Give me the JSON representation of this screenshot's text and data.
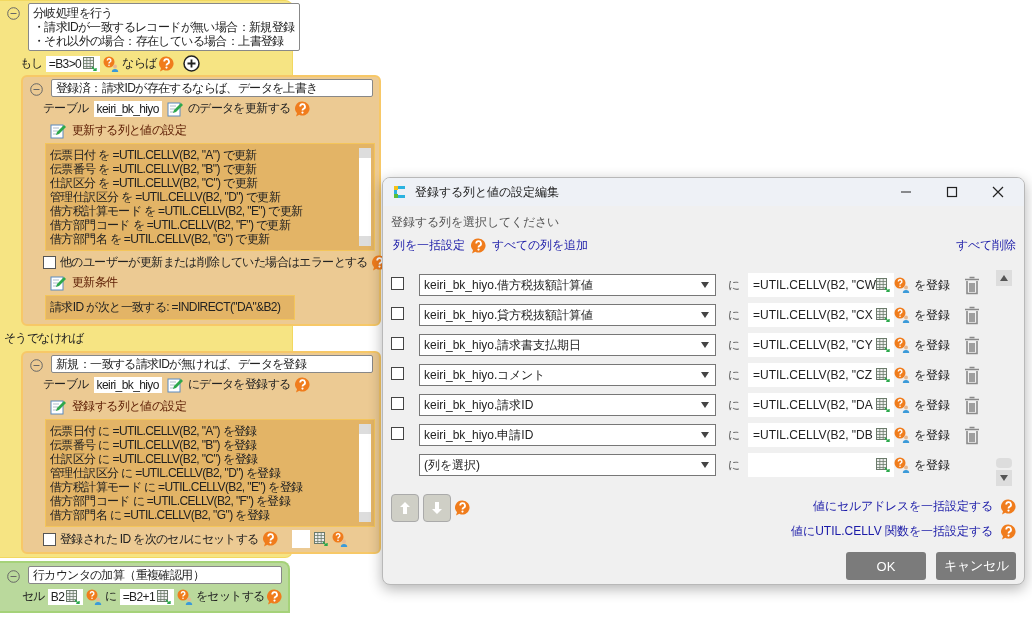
{
  "branch": {
    "title_lines": [
      "分岐処理を行う",
      "・請求IDが一致するレコードが無い場合：新規登録",
      "・それ以外の場合：存在している場合：上書登録"
    ],
    "if_label": "もし",
    "condition": "=B3>0",
    "then_label": "ならば",
    "then_block": {
      "title": "登録済：請求IDが存在するならば、データを上書き",
      "table_label": "テーブル",
      "table": "keiri_bk_hiyo",
      "action": "のデータを更新する",
      "settings_label": "更新する列と値の設定",
      "settings_lines": [
        "伝票日付 を =UTIL.CELLV(B2, \"A\") で更新",
        "伝票番号 を =UTIL.CELLV(B2, \"B\") で更新",
        "仕訳区分 を =UTIL.CELLV(B2, \"C\") で更新",
        "管理仕訳区分 を =UTIL.CELLV(B2, \"D\") で更新",
        "借方税計算モード を =UTIL.CELLV(B2, \"E\") で更新",
        "借方部門コード を =UTIL.CELLV(B2, \"F\") で更新",
        "借方部門名 を =UTIL.CELLV(B2, \"G\") で更新"
      ],
      "checkbox": {
        "label": "他のユーザーが更新または削除していた場合はエラーとする",
        "checked": false
      },
      "condition_label": "更新条件",
      "condition": "請求ID が次と一致する: =INDIRECT(\"DA\"&B2)"
    },
    "else_label": "そうでなければ",
    "else_block": {
      "title": "新規：一致する請求IDが無ければ、データを登録",
      "table_label": "テーブル",
      "table": "keiri_bk_hiyo",
      "action": "にデータを登録する",
      "settings_label": "登録する列と値の設定",
      "settings_lines": [
        "伝票日付 に =UTIL.CELLV(B2, \"A\") を登録",
        "伝票番号 に =UTIL.CELLV(B2, \"B\") を登録",
        "仕訳区分 に =UTIL.CELLV(B2, \"C\") を登録",
        "管理仕訳区分 に =UTIL.CELLV(B2, \"D\") を登録",
        "借方税計算モード に =UTIL.CELLV(B2, \"E\") を登録",
        "借方部門コード に =UTIL.CELLV(B2, \"F\") を登録",
        "借方部門名 に =UTIL.CELLV(B2, \"G\") を登録"
      ],
      "checkbox": {
        "label": "登録された ID を次のセルにセットする",
        "checked": false
      }
    }
  },
  "counter": {
    "title": "行カウンタの加算（重複確認用）",
    "cell_label": "セル",
    "cell": "B2",
    "to_label": "に",
    "value": "=B2+1",
    "action": "をセットする"
  },
  "dialog": {
    "title": "登録する列と値の設定編集",
    "instruction": "登録する列を選択してください",
    "bulk_link": "列を一括設定",
    "add_all_link": "すべての列を追加",
    "delete_all_link": "すべて削除",
    "rows": [
      {
        "kind": "mapping",
        "checked": false,
        "column": "keiri_bk_hiyo.借方税抜額計算値",
        "to": "に",
        "value": "=UTIL.CELLV(B2, \"CW",
        "suffix": "を登録"
      },
      {
        "kind": "mapping",
        "checked": false,
        "column": "keiri_bk_hiyo.貸方税抜額計算値",
        "to": "に",
        "value": "=UTIL.CELLV(B2, \"CX",
        "suffix": "を登録"
      },
      {
        "kind": "mapping",
        "checked": false,
        "column": "keiri_bk_hiyo.請求書支払期日",
        "to": "に",
        "value": "=UTIL.CELLV(B2, \"CY",
        "suffix": "を登録"
      },
      {
        "kind": "mapping",
        "checked": false,
        "column": "keiri_bk_hiyo.コメント",
        "to": "に",
        "value": "=UTIL.CELLV(B2, \"CZ",
        "suffix": "を登録"
      },
      {
        "kind": "mapping",
        "checked": false,
        "column": "keiri_bk_hiyo.請求ID",
        "to": "に",
        "value": "=UTIL.CELLV(B2, \"DA",
        "suffix": "を登録"
      },
      {
        "kind": "mapping",
        "checked": false,
        "column": "keiri_bk_hiyo.申請ID",
        "to": "に",
        "value": "=UTIL.CELLV(B2, \"DB",
        "suffix": "を登録"
      },
      {
        "kind": "new",
        "column": "(列を選択)",
        "to": "に",
        "suffix": "を登録"
      }
    ],
    "address_link": "値にセルアドレスを一括設定する",
    "cellv_link": "値にUTIL.CELLV 関数を一括設定する",
    "ok": "OK",
    "cancel": "キャンセル"
  }
}
